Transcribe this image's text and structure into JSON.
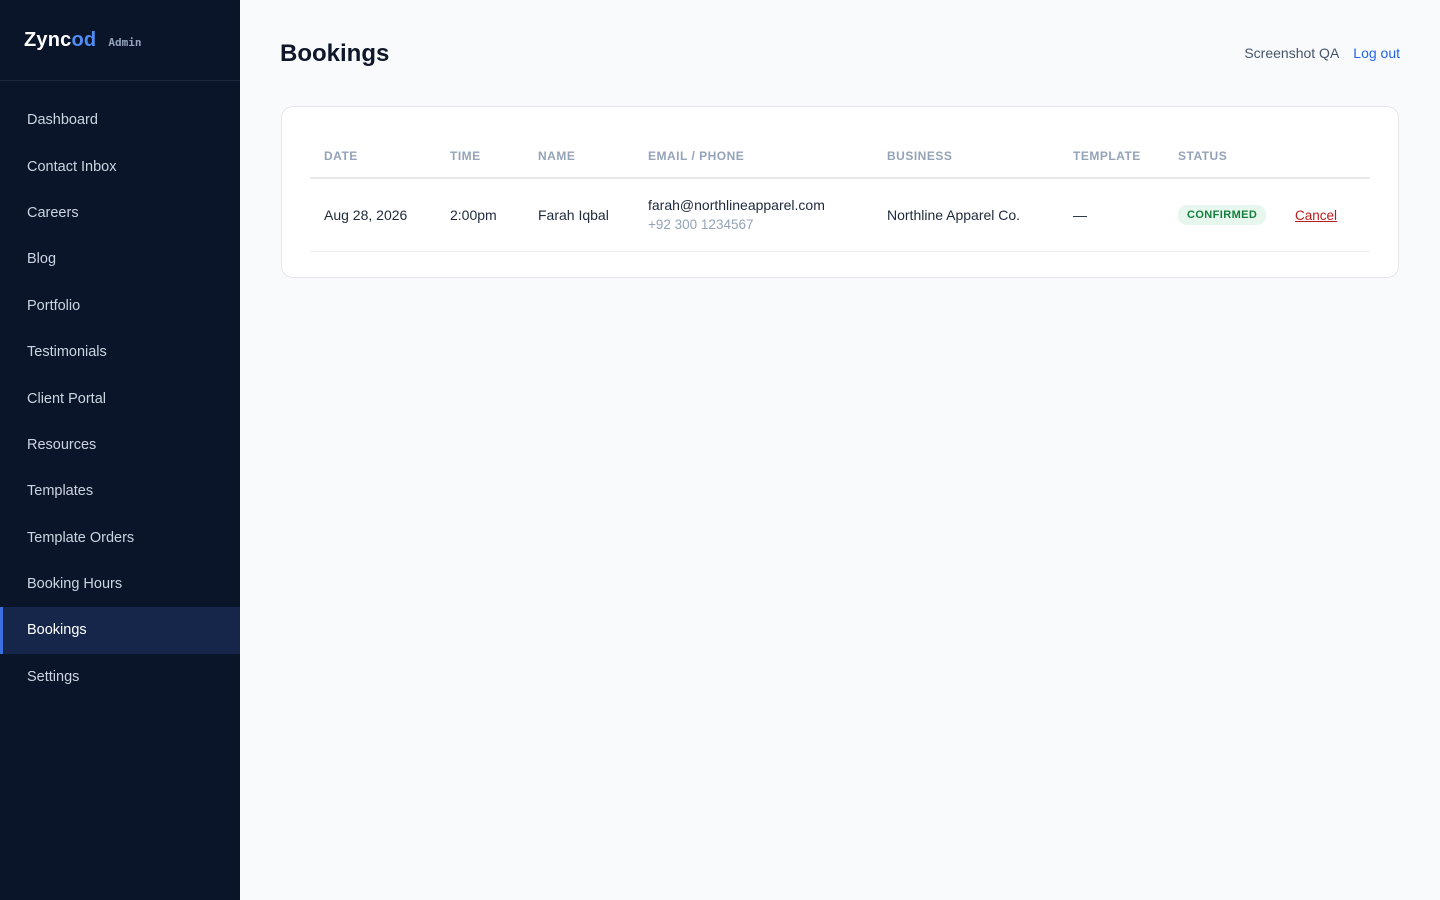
{
  "brand": {
    "name_primary": "Zync",
    "name_accent": "od",
    "tag": "Admin"
  },
  "sidebar": {
    "items": [
      {
        "label": "Dashboard",
        "active": false
      },
      {
        "label": "Contact Inbox",
        "active": false
      },
      {
        "label": "Careers",
        "active": false
      },
      {
        "label": "Blog",
        "active": false
      },
      {
        "label": "Portfolio",
        "active": false
      },
      {
        "label": "Testimonials",
        "active": false
      },
      {
        "label": "Client Portal",
        "active": false
      },
      {
        "label": "Resources",
        "active": false
      },
      {
        "label": "Templates",
        "active": false
      },
      {
        "label": "Template Orders",
        "active": false
      },
      {
        "label": "Booking Hours",
        "active": false
      },
      {
        "label": "Bookings",
        "active": true
      },
      {
        "label": "Settings",
        "active": false
      }
    ]
  },
  "header": {
    "title": "Bookings",
    "user_name": "Screenshot QA",
    "logout_label": "Log out"
  },
  "table": {
    "columns": [
      "DATE",
      "TIME",
      "NAME",
      "EMAIL / PHONE",
      "BUSINESS",
      "TEMPLATE",
      "STATUS",
      ""
    ],
    "rows": [
      {
        "date": "Aug 28, 2026",
        "time": "2:00pm",
        "name": "Farah Iqbal",
        "email": "farah@northlineapparel.com",
        "phone": "+92 300 1234567",
        "business": "Northline Apparel Co.",
        "template": "—",
        "status": "CONFIRMED",
        "action_label": "Cancel"
      }
    ]
  },
  "colors": {
    "sidebar_bg": "#0b1529",
    "accent": "#3b6fe0",
    "status_confirmed": "#15803d",
    "danger": "#b91c1c"
  }
}
